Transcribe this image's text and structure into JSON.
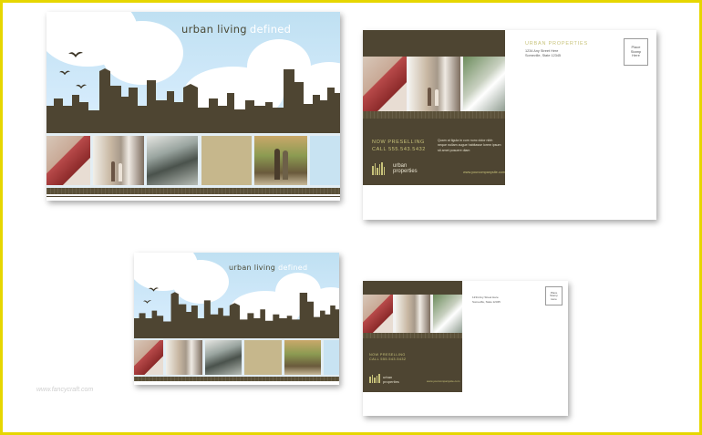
{
  "headline": {
    "main": "urban living",
    "accent": "defined"
  },
  "back": {
    "company": "URBAN PROPERTIES",
    "address_line1": "1234 Any Street Here",
    "address_line2": "Someville, State 12345",
    "stamp": "Place\nStamp\nHere",
    "now_preselling": "NOW PRESELLING",
    "phone": "CALL 555.543.5432",
    "blurb": "Quam at ligula in cum nunc dolor nibh neque nullam augue habitasse lorem ipsum sit amet posuere diam",
    "logo_line1": "urban",
    "logo_line2": "properties",
    "website": "www.yourcompanysite.com"
  },
  "watermark": "www.fancycraft.com",
  "colors": {
    "brown": "#4e4532",
    "sky": "#bfe0f2",
    "accent_green": "#c8c37a",
    "frame": "#e6d600"
  }
}
